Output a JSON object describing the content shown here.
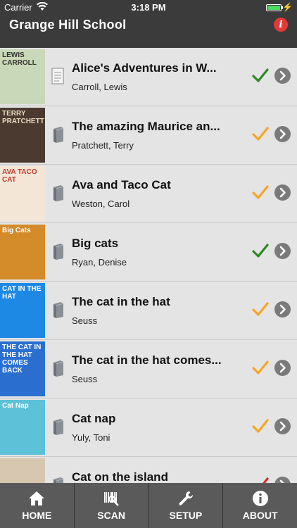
{
  "status_bar": {
    "carrier": "Carrier",
    "time": "3:18 PM"
  },
  "header": {
    "title": "Grange Hill School"
  },
  "books": [
    {
      "title": "Alice's Adventures in W...",
      "author": "Carroll, Lewis",
      "cover_text": "LEWIS CARROLL",
      "cover_bg": "#c9d8b8",
      "cover_fg": "#333",
      "status": "green",
      "book_icon": "document-icon"
    },
    {
      "title": "The amazing Maurice an...",
      "author": "Pratchett, Terry",
      "cover_text": "TERRY PRATCHETT",
      "cover_bg": "#4a3a30",
      "cover_fg": "#e8dcc0",
      "status": "orange",
      "book_icon": "book-icon"
    },
    {
      "title": "Ava and Taco Cat",
      "author": "Weston, Carol",
      "cover_text": "AVA TACO CAT",
      "cover_bg": "#f3e6d6",
      "cover_fg": "#c0392b",
      "status": "orange",
      "book_icon": "book-icon"
    },
    {
      "title": "Big cats",
      "author": "Ryan, Denise",
      "cover_text": "Big Cats",
      "cover_bg": "#d48b2a",
      "cover_fg": "#fff",
      "status": "green",
      "book_icon": "book-icon"
    },
    {
      "title": "The cat in the hat",
      "author": "Seuss",
      "cover_text": "CAT IN THE HAT",
      "cover_bg": "#1e88e5",
      "cover_fg": "#fff",
      "status": "orange",
      "book_icon": "book-icon"
    },
    {
      "title": "The cat in the hat comes...",
      "author": "Seuss",
      "cover_text": "THE CAT IN THE HAT COMES BACK",
      "cover_bg": "#2a6fd0",
      "cover_fg": "#fff",
      "status": "orange",
      "book_icon": "book-icon"
    },
    {
      "title": "Cat nap",
      "author": "Yuly, Toni",
      "cover_text": "Cat Nap",
      "cover_bg": "#5dc1d8",
      "cover_fg": "#fff",
      "status": "orange",
      "book_icon": "book-icon"
    },
    {
      "title": "Cat on the island",
      "author": "",
      "cover_text": "",
      "cover_bg": "#d7c7b0",
      "cover_fg": "#333",
      "status": "red",
      "book_icon": "book-icon"
    }
  ],
  "tabs": [
    {
      "label": "HOME",
      "icon": "home-icon"
    },
    {
      "label": "SCAN",
      "icon": "barcode-icon"
    },
    {
      "label": "SETUP",
      "icon": "wrench-icon"
    },
    {
      "label": "ABOUT",
      "icon": "info-icon"
    }
  ],
  "colors": {
    "bar_bg": "#3b3b3b",
    "check_green": "#2e8b22",
    "check_orange": "#f5a623",
    "check_red": "#d0302a",
    "info_red": "#e53935"
  }
}
